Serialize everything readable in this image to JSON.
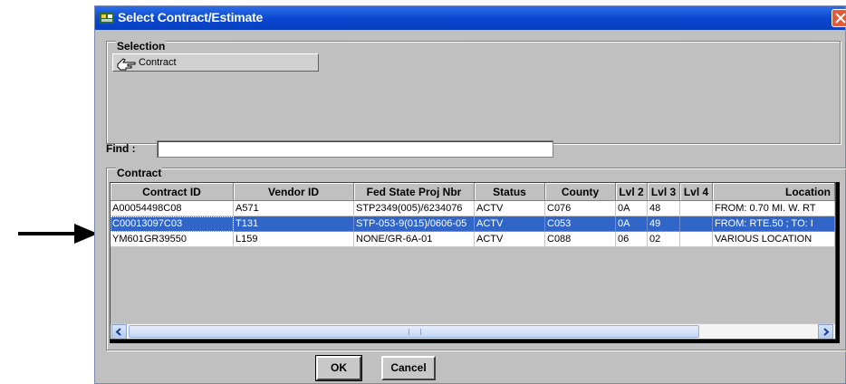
{
  "window": {
    "title": "Select Contract/Estimate"
  },
  "selection": {
    "group_label": "Selection",
    "contract_button_label": "Contract"
  },
  "find": {
    "label": "Find :",
    "value": ""
  },
  "contract_group": {
    "label": "Contract"
  },
  "table": {
    "columns": [
      "Contract ID",
      "Vendor ID",
      "Fed State Proj Nbr",
      "Status",
      "County",
      "Lvl 2",
      "Lvl 3",
      "Lvl 4",
      "Location"
    ],
    "rows": [
      [
        "A00054498C08",
        "A571",
        "STP2349(005)/6234076",
        "ACTV",
        "C076",
        "0A",
        "48",
        "",
        "FROM: 0.70 MI. W. RT"
      ],
      [
        "C00013097C03",
        "T131",
        "STP-053-9(015)/0606-05",
        "ACTV",
        "C053",
        "0A",
        "49",
        "",
        "FROM: RTE.50 ; TO: I"
      ],
      [
        "YM601GR39550",
        "L159",
        "NONE/GR-6A-01",
        "ACTV",
        "C088",
        "06",
        "02",
        "",
        "VARIOUS LOCATION"
      ]
    ],
    "selected_row": 1
  },
  "buttons": {
    "ok": "OK",
    "cancel": "Cancel"
  },
  "colors": {
    "titlebar": "#0a48d0",
    "selection_highlight": "#3166c8",
    "dialog_bg": "#c0c0c0"
  },
  "icons": {
    "title": "app-icon",
    "close": "close-icon",
    "contract": "pointing-hand-icon",
    "annotation": "arrow-right-icon"
  }
}
